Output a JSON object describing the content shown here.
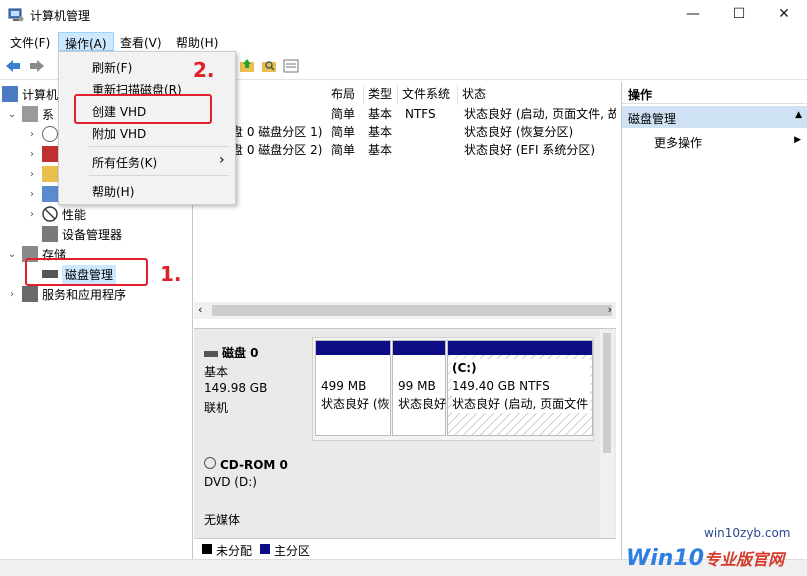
{
  "window": {
    "title": "计算机管理",
    "minimize": "—",
    "maximize": "☐",
    "close": "✕"
  },
  "menubar": {
    "items": [
      "文件(F)",
      "操作(A)",
      "查看(V)",
      "帮助(H)"
    ]
  },
  "dropdown": {
    "items": [
      "刷新(F)",
      "重新扫描磁盘(R)",
      "创建 VHD",
      "附加 VHD",
      "所有任务(K)",
      "帮助(H)"
    ],
    "submenu_arrow": "›"
  },
  "tree": {
    "root": "计算机",
    "system_partial": "系",
    "performance": "性能",
    "device_manager": "设备管理器",
    "storage": "存储",
    "disk_management": "磁盘管理",
    "services": "服务和应用程序"
  },
  "volume_list": {
    "columns": [
      "布局",
      "类型",
      "文件系统",
      "状态"
    ],
    "rows": [
      {
        "name": ")",
        "layout": "简单",
        "type": "基本",
        "fs": "NTFS",
        "status": "状态良好 (启动, 页面文件, 故"
      },
      {
        "name": "盘 0 磁盘分区 1)",
        "layout": "简单",
        "type": "基本",
        "fs": "",
        "status": "状态良好 (恢复分区)"
      },
      {
        "name": "盘 0 磁盘分区 2)",
        "layout": "简单",
        "type": "基本",
        "fs": "",
        "status": "状态良好 (EFI 系统分区)"
      }
    ]
  },
  "disks": [
    {
      "name": "磁盘 0",
      "type": "基本",
      "size": "149.98 GB",
      "status": "联机",
      "partitions": [
        {
          "label": "",
          "size": "499 MB",
          "status": "状态良好 (恢"
        },
        {
          "label": "",
          "size": "99 MB",
          "status": "状态良好"
        },
        {
          "label": "(C:)",
          "size": "149.40 GB NTFS",
          "status": "状态良好 (启动, 页面文件"
        }
      ]
    },
    {
      "name": "CD-ROM 0",
      "type": "DVD (D:)",
      "status": "无媒体"
    }
  ],
  "legend": {
    "unallocated": "未分配",
    "primary": "主分区",
    "unallocated_color": "#000000",
    "primary_color": "#0c0c84"
  },
  "actions_pane": {
    "header": "操作",
    "section": "磁盘管理",
    "more": "更多操作",
    "section_arrow": "▲",
    "more_arrow": "▶"
  },
  "annotations": {
    "step1": "1.",
    "step2": "2."
  },
  "watermark": {
    "url": "win10zyb.com",
    "brand_prefix": "Win10",
    "brand_suffix": "专业版官网"
  },
  "colors": {
    "accent": "#cce8ff",
    "annotation": "#e0202a",
    "partition_bar": "#0c0c84"
  }
}
